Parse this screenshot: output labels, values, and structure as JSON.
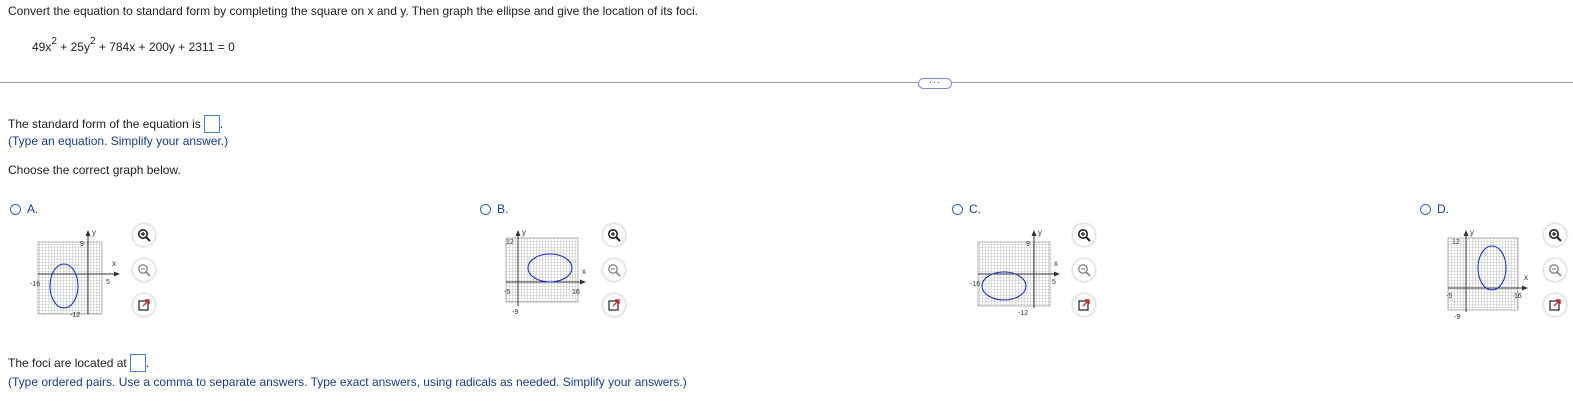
{
  "question": {
    "instruction": "Convert the equation to standard form by completing the square on x and y.  Then graph the ellipse and give the location of its foci.",
    "equation": {
      "t1": "49x",
      "e1": "2",
      "t2": " + 25y",
      "e2": "2",
      "t3": " + 784x + 200y + 2311 = 0"
    }
  },
  "expand_button": "···",
  "standard_form": {
    "prompt": "The standard form of the equation is",
    "period": ".",
    "hint": "(Type an equation. Simplify your answer.)"
  },
  "choose_label": "Choose the correct graph below.",
  "options": [
    {
      "label": "A.",
      "y_top": "9",
      "x_left": "-16",
      "x_right": "5",
      "y_bottom": "-12",
      "axis_x": "x",
      "axis_y": "y"
    },
    {
      "label": "B.",
      "y_top": "12",
      "x_left": "-5",
      "x_right": "16",
      "y_bottom": "-9",
      "axis_x": "x",
      "axis_y": "y"
    },
    {
      "label": "C.",
      "y_top": "9",
      "x_left": "-16",
      "x_right": "5",
      "y_bottom": "-12",
      "axis_x": "x",
      "axis_y": "y"
    },
    {
      "label": "D.",
      "y_top": "12",
      "x_left": "-5",
      "x_right": "16",
      "y_bottom": "-9",
      "axis_x": "x",
      "axis_y": "y"
    }
  ],
  "tools": {
    "zoom_in": "zoom-in-icon",
    "zoom_out": "zoom-out-icon",
    "popout": "popout-icon"
  },
  "foci": {
    "prompt": "The foci are located at",
    "period": ".",
    "hint": "(Type ordered pairs. Use a comma to separate answers. Type exact answers, using radicals as needed. Simplify your answers.)"
  },
  "colors": {
    "accent": "#1a3a8a",
    "ellipse": "#2233cc",
    "input_border": "#4a7bd0"
  }
}
